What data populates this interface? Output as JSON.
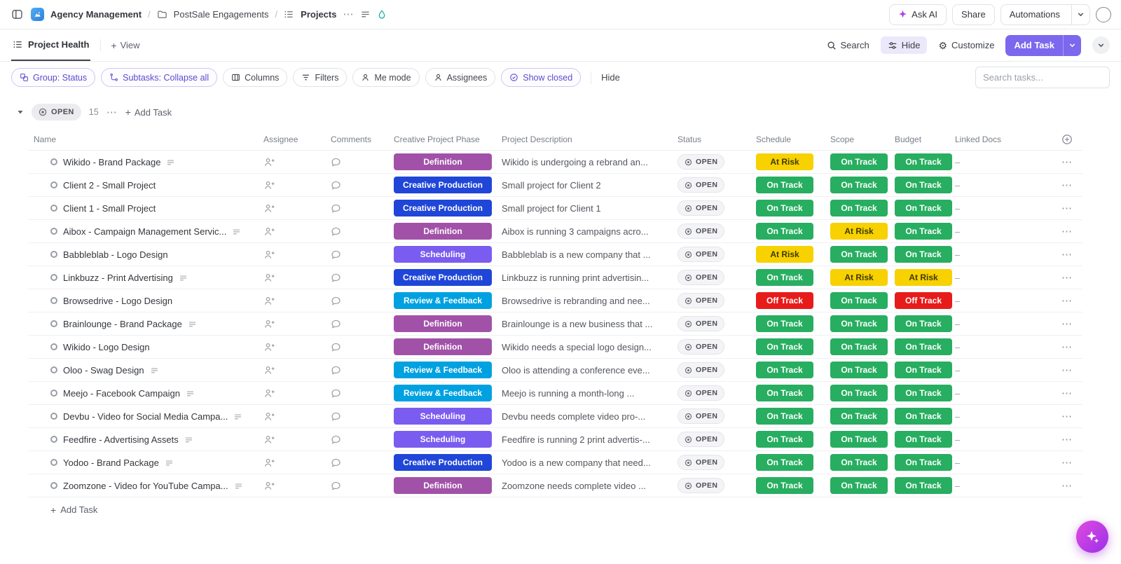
{
  "icons": {
    "ellipsis": "⋯",
    "plus": "+",
    "separator": "/",
    "dash": "–"
  },
  "topbar": {
    "breadcrumb": [
      "Agency Management",
      "PostSale Engagements",
      "Projects"
    ],
    "ask_ai": "Ask AI",
    "share": "Share",
    "automations": "Automations"
  },
  "viewbar": {
    "view_name": "Project Health",
    "add_view": "View",
    "search": "Search",
    "hide": "Hide",
    "customize": "Customize",
    "add_task": "Add Task"
  },
  "toolbar": {
    "group": "Group: Status",
    "subtasks": "Subtasks: Collapse all",
    "columns": "Columns",
    "filters": "Filters",
    "me_mode": "Me mode",
    "assignees": "Assignees",
    "show_closed": "Show closed",
    "hide": "Hide",
    "search_placeholder": "Search tasks..."
  },
  "group": {
    "status": "OPEN",
    "count": "15",
    "add_task": "Add Task"
  },
  "table": {
    "headers": [
      "Name",
      "Assignee",
      "Comments",
      "Creative Project Phase",
      "Project Description",
      "Status",
      "Schedule",
      "Scope",
      "Budget",
      "Linked Docs"
    ],
    "rows": [
      {
        "name": "Wikido - Brand Package",
        "doc": true,
        "phase": "Definition",
        "description": "Wikido is undergoing a rebrand an...",
        "status": "OPEN",
        "schedule": "At Risk",
        "scope": "On Track",
        "budget": "On Track",
        "linked_docs": "–"
      },
      {
        "name": "Client 2 - Small Project",
        "doc": false,
        "phase": "Creative Production",
        "description": "Small project for Client 2",
        "status": "OPEN",
        "schedule": "On Track",
        "scope": "On Track",
        "budget": "On Track",
        "linked_docs": "–"
      },
      {
        "name": "Client 1 - Small Project",
        "doc": false,
        "phase": "Creative Production",
        "description": "Small project for Client 1",
        "status": "OPEN",
        "schedule": "On Track",
        "scope": "On Track",
        "budget": "On Track",
        "linked_docs": "–"
      },
      {
        "name": "Aibox - Campaign Management Servic...",
        "doc": true,
        "phase": "Definition",
        "description": "Aibox is running 3 campaigns acro...",
        "status": "OPEN",
        "schedule": "On Track",
        "scope": "At Risk",
        "budget": "On Track",
        "linked_docs": "–"
      },
      {
        "name": "Babbleblab - Logo Design",
        "doc": false,
        "phase": "Scheduling",
        "description": "Babbleblab is a new company that ...",
        "status": "OPEN",
        "schedule": "At Risk",
        "scope": "On Track",
        "budget": "On Track",
        "linked_docs": "–"
      },
      {
        "name": "Linkbuzz - Print Advertising",
        "doc": true,
        "phase": "Creative Production",
        "description": "Linkbuzz is running print advertisin...",
        "status": "OPEN",
        "schedule": "On Track",
        "scope": "At Risk",
        "budget": "At Risk",
        "linked_docs": "–"
      },
      {
        "name": "Browsedrive - Logo Design",
        "doc": false,
        "phase": "Review & Feedback",
        "description": "Browsedrive is rebranding and nee...",
        "status": "OPEN",
        "schedule": "Off Track",
        "scope": "On Track",
        "budget": "Off Track",
        "linked_docs": "–"
      },
      {
        "name": "Brainlounge - Brand Package",
        "doc": true,
        "phase": "Definition",
        "description": "Brainlounge is a new business that ...",
        "status": "OPEN",
        "schedule": "On Track",
        "scope": "On Track",
        "budget": "On Track",
        "linked_docs": "–"
      },
      {
        "name": "Wikido - Logo Design",
        "doc": false,
        "phase": "Definition",
        "description": "Wikido needs a special logo design...",
        "status": "OPEN",
        "schedule": "On Track",
        "scope": "On Track",
        "budget": "On Track",
        "linked_docs": "–"
      },
      {
        "name": "Oloo - Swag Design",
        "doc": true,
        "phase": "Review & Feedback",
        "description": "Oloo is attending a conference eve...",
        "status": "OPEN",
        "schedule": "On Track",
        "scope": "On Track",
        "budget": "On Track",
        "linked_docs": "–"
      },
      {
        "name": "Meejo - Facebook Campaign",
        "doc": true,
        "phase": "Review & Feedback",
        "description": "Meejo is running a month-long ...",
        "status": "OPEN",
        "schedule": "On Track",
        "scope": "On Track",
        "budget": "On Track",
        "linked_docs": "–"
      },
      {
        "name": "Devbu - Video for Social Media Campa...",
        "doc": true,
        "phase": "Scheduling",
        "description": "Devbu needs complete video pro-...",
        "status": "OPEN",
        "schedule": "On Track",
        "scope": "On Track",
        "budget": "On Track",
        "linked_docs": "–"
      },
      {
        "name": "Feedfire - Advertising Assets",
        "doc": true,
        "phase": "Scheduling",
        "description": "Feedfire is running 2 print advertis-...",
        "status": "OPEN",
        "schedule": "On Track",
        "scope": "On Track",
        "budget": "On Track",
        "linked_docs": "–"
      },
      {
        "name": "Yodoo - Brand Package",
        "doc": true,
        "phase": "Creative Production",
        "description": "Yodoo is a new company that need...",
        "status": "OPEN",
        "schedule": "On Track",
        "scope": "On Track",
        "budget": "On Track",
        "linked_docs": "–"
      },
      {
        "name": "Zoomzone - Video for YouTube Campa...",
        "doc": true,
        "phase": "Definition",
        "description": "Zoomzone needs complete video ...",
        "status": "OPEN",
        "schedule": "On Track",
        "scope": "On Track",
        "budget": "On Track",
        "linked_docs": "–"
      }
    ]
  },
  "footer": {
    "add_task": "Add Task"
  },
  "colors": {
    "accent": "#7b68ee",
    "phase": {
      "Definition": "#a152a8",
      "Creative Production": "#1f46d8",
      "Scheduling": "#7a5cf0",
      "Review & Feedback": "#00a1e0"
    },
    "health": {
      "On Track": {
        "bg": "#27ae60",
        "fg": "#ffffff"
      },
      "At Risk": {
        "bg": "#f7d100",
        "fg": "#3d3a00"
      },
      "Off Track": {
        "bg": "#e81b1b",
        "fg": "#ffffff"
      }
    }
  }
}
